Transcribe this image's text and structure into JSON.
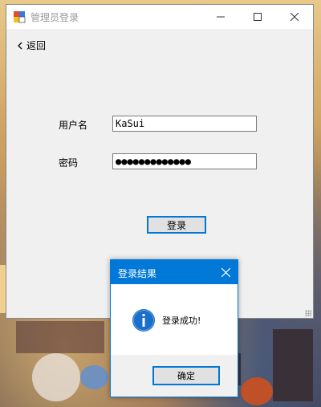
{
  "window": {
    "title": "管理员登录",
    "back_label": "返回"
  },
  "form": {
    "username_label": "用户名",
    "username_value": "KaSui",
    "password_label": "密码",
    "password_value": "●●●●●●●●●●●●●",
    "login_button": "登录"
  },
  "dialog": {
    "title": "登录结果",
    "message": "登录成功!",
    "ok_button": "确定"
  },
  "colors": {
    "accent": "#0078d7",
    "window_bg": "#f0f0f0"
  },
  "icons": {
    "app": "app-icon",
    "back": "chevron-left-icon",
    "info": "info-icon",
    "close": "close-icon"
  }
}
